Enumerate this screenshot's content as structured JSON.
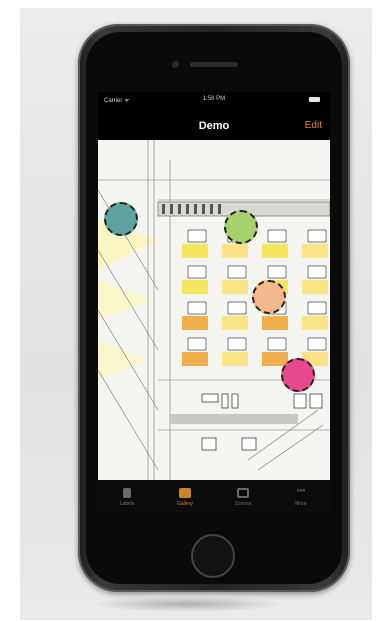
{
  "status_bar": {
    "carrier": "Carrier ᯤ",
    "time": "1:58 PM"
  },
  "nav": {
    "title": "Demo",
    "edit_label": "Edit"
  },
  "colors": {
    "accent": "#e0882a",
    "pin_teal": "#5fa3a0",
    "pin_green": "#a6d26e",
    "pin_peach": "#f4b98a",
    "pin_pink": "#e64a8c"
  },
  "pins": [
    {
      "name": "teal",
      "color": "#5fa3a0"
    },
    {
      "name": "green",
      "color": "#a6d26e"
    },
    {
      "name": "peach",
      "color": "#f4b98a"
    },
    {
      "name": "pink",
      "color": "#e64a8c"
    }
  ],
  "tabs": [
    {
      "label": "Labels",
      "icon": "labels-icon",
      "active": false
    },
    {
      "label": "Gallery",
      "icon": "gallery-icon",
      "active": true
    },
    {
      "label": "Scenes",
      "icon": "scenes-icon",
      "active": false
    },
    {
      "label": "More",
      "icon": "more-icon",
      "active": false
    }
  ]
}
